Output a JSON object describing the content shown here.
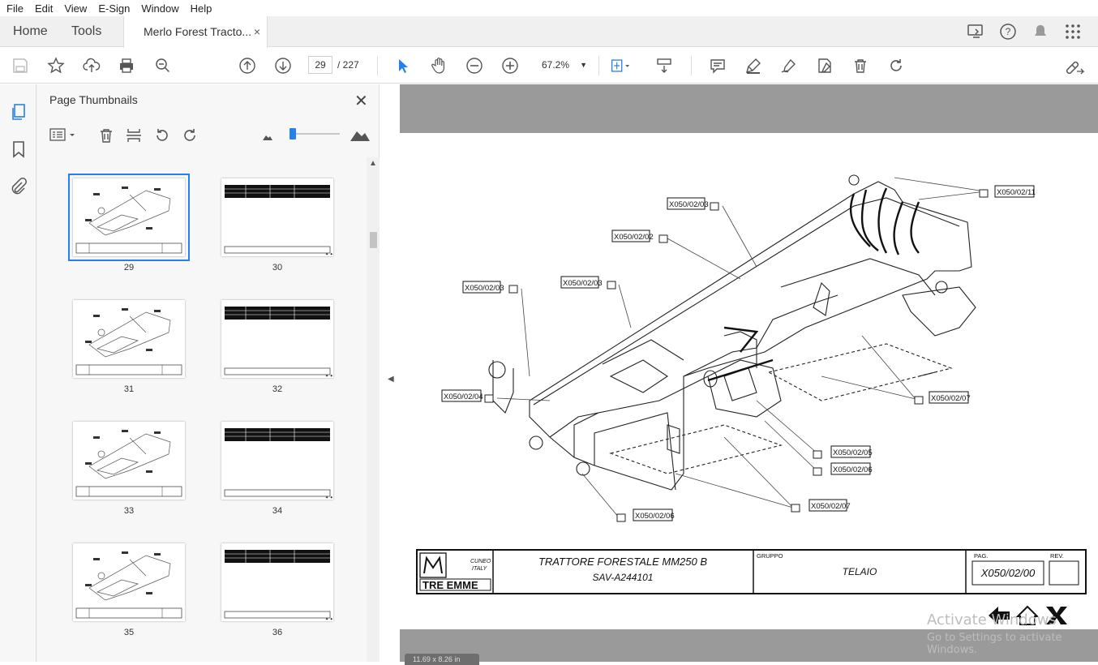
{
  "menu": [
    "File",
    "Edit",
    "View",
    "E-Sign",
    "Window",
    "Help"
  ],
  "tabs": {
    "home": "Home",
    "tools": "Tools",
    "doc": "Merlo Forest Tracto...",
    "close": "×"
  },
  "toolbar": {
    "page_current": "29",
    "page_total": "/ 227",
    "zoom": "67.2%"
  },
  "panel": {
    "title": "Page Thumbnails",
    "thumbnails": [
      {
        "num": "29",
        "type": "drawing",
        "selected": true
      },
      {
        "num": "30",
        "type": "table",
        "selected": false
      },
      {
        "num": "31",
        "type": "drawing",
        "selected": false
      },
      {
        "num": "32",
        "type": "table",
        "selected": false
      },
      {
        "num": "33",
        "type": "drawing",
        "selected": false
      },
      {
        "num": "34",
        "type": "table",
        "selected": false
      },
      {
        "num": "35",
        "type": "drawing",
        "selected": false
      },
      {
        "num": "36",
        "type": "table",
        "selected": false
      }
    ]
  },
  "drawing": {
    "labels": [
      "X050/02/03",
      "X050/02/02",
      "X050/02/03",
      "X050/02/03",
      "X050/02/11",
      "X050/02/04",
      "X050/02/07",
      "X050/02/05",
      "X050/02/06",
      "X050/02/07",
      "X050/02/06"
    ],
    "title_line1": "TRATTORE FORESTALE MM250 B",
    "title_line2": "SAV-A244101",
    "gruppo_label": "GRUPPO",
    "gruppo_value": "TELAIO",
    "pag_label": "PAG.",
    "pag_value": "X050/02/00",
    "rev_label": "REV.",
    "logo_brand": "TRE EMME",
    "logo_place1": "CUNEO",
    "logo_place2": "ITALY"
  },
  "watermark": {
    "line1": "Activate Windows",
    "line2": "Go to Settings to activate Windows."
  },
  "status": "11.69 x 8.26 in",
  "colors": {
    "accent": "#2680eb",
    "viewer_bg": "#9a9a9a",
    "panel_bg": "#f7f7f7"
  }
}
